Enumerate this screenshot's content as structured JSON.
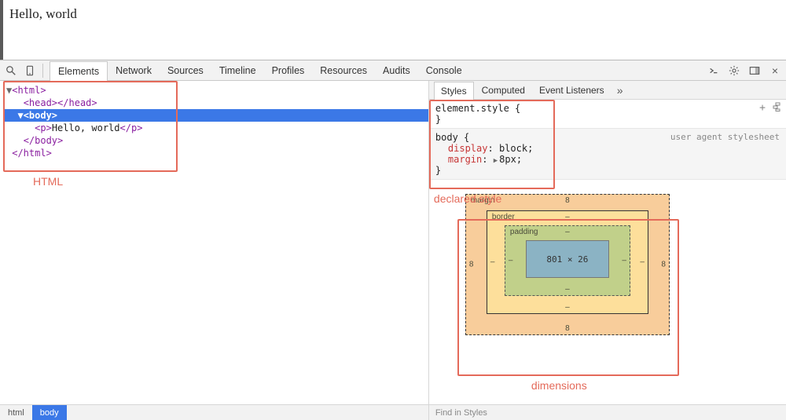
{
  "page": {
    "body_text": "Hello, world"
  },
  "toolbar": {
    "tabs": [
      "Elements",
      "Network",
      "Sources",
      "Timeline",
      "Profiles",
      "Resources",
      "Audits",
      "Console"
    ],
    "active_tab": 0
  },
  "dom_tree": {
    "lines": [
      {
        "indent": 0,
        "arrow": "▼",
        "html": "<html>",
        "cls": "tag"
      },
      {
        "indent": 1,
        "arrow": "",
        "html": "<head></head>",
        "cls": "tag"
      },
      {
        "indent": 1,
        "arrow": "▼",
        "html": "<body>",
        "cls": "tag",
        "selected": true,
        "bold": true
      },
      {
        "indent": 2,
        "arrow": "",
        "html": "<p>Hello, world</p>",
        "cls": "mix"
      },
      {
        "indent": 1,
        "arrow": "",
        "html": "</body>",
        "cls": "tag"
      },
      {
        "indent": 0,
        "arrow": "",
        "html": "</html>",
        "cls": "tag"
      }
    ]
  },
  "breadcrumb": [
    {
      "label": "html",
      "active": false
    },
    {
      "label": "body",
      "active": true
    }
  ],
  "styles_tabs": {
    "items": [
      "Styles",
      "Computed",
      "Event Listeners"
    ],
    "active": 0,
    "overflow": "»"
  },
  "rules": [
    {
      "selector": "element.style",
      "origin": "",
      "props": [],
      "ua": false,
      "tools": true
    },
    {
      "selector": "body",
      "origin": "user agent stylesheet",
      "props": [
        {
          "name": "display",
          "value": "block"
        },
        {
          "name": "margin",
          "value": "8px",
          "expandable": true
        }
      ],
      "ua": true,
      "tools": false
    }
  ],
  "box_model": {
    "margin": {
      "top": "8",
      "right": "8",
      "bottom": "8",
      "left": "8",
      "label": "margin"
    },
    "border": {
      "top": "–",
      "right": "–",
      "bottom": "–",
      "left": "–",
      "label": "border"
    },
    "padding": {
      "top": "–",
      "right": "–",
      "bottom": "–",
      "left": "–",
      "label": "padding"
    },
    "content": "801 × 26"
  },
  "find_placeholder": "Find in Styles",
  "annotations": {
    "html_box_label": "HTML",
    "style_box_label": "declared style",
    "dim_box_label": "dimensions"
  }
}
